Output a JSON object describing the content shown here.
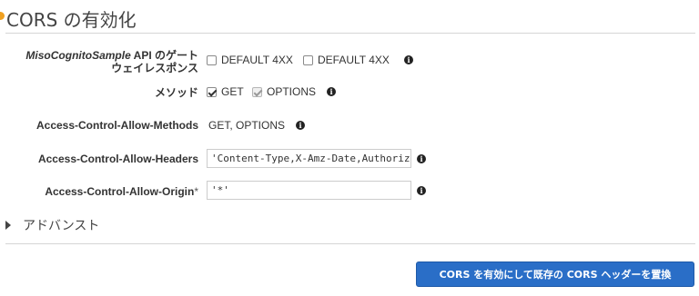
{
  "panel": {
    "title": "CORS の有効化"
  },
  "gateway_responses": {
    "label_italic": "MisoCognitoSample",
    "label_rest_line1": " API のゲート",
    "label_line2": "ウェイレスポンス",
    "options": [
      {
        "label": "DEFAULT 4XX",
        "checked": false
      },
      {
        "label": "DEFAULT 4XX",
        "checked": false
      }
    ],
    "info_icon": "i"
  },
  "methods": {
    "label": "メソッド",
    "options": [
      {
        "label": "GET",
        "checked": true
      },
      {
        "label": "OPTIONS",
        "checked": true,
        "disabled": true
      }
    ],
    "info_icon": "i"
  },
  "allow_methods": {
    "label": "Access-Control-Allow-Methods",
    "value": "GET, OPTIONS",
    "info_icon": "i"
  },
  "allow_headers": {
    "label": "Access-Control-Allow-Headers",
    "value": "'Content-Type,X-Amz-Date,Authoriz",
    "info_icon": "i"
  },
  "allow_origin": {
    "label": "Access-Control-Allow-Origin",
    "required_mark": "*",
    "value": "'*'",
    "info_icon": "i"
  },
  "advanced": {
    "label": "アドバンスト"
  },
  "submit": {
    "label": "CORS を有効にして既存の CORS ヘッダーを置換"
  },
  "colors": {
    "accent": "#2a6ec7",
    "title_dot": "#f0a020"
  }
}
